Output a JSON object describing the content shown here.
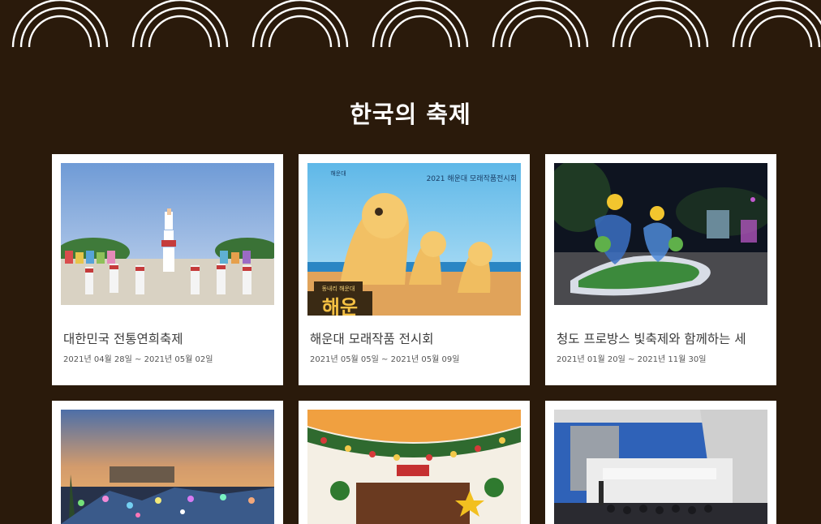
{
  "page": {
    "title": "한국의 축제"
  },
  "festivals": [
    {
      "name": "대한민국 전통연희축제",
      "date": "2021년 04월 28일 ~ 2021년 05월 02일"
    },
    {
      "name": "해운대 모래작품 전시회",
      "date": "2021년 05월 05일 ~ 2021년 05월 09일"
    },
    {
      "name": "청도 프로방스 빛축제와 함께하는 세",
      "date": "2021년 01월 20일 ~ 2021년 11월 30일"
    },
    {
      "name": "",
      "date": ""
    },
    {
      "name": "",
      "date": ""
    },
    {
      "name": "",
      "date": ""
    }
  ],
  "images": {
    "sand_banner": "2021 해운대 모래작품전시회",
    "sand_logo": "해운대",
    "sand_sign": "동내리 해운대",
    "sand_letters": "해운"
  },
  "colors": {
    "background": "#2a1a0b",
    "card": "#ffffff",
    "pattern_stroke": "#ffffff"
  }
}
